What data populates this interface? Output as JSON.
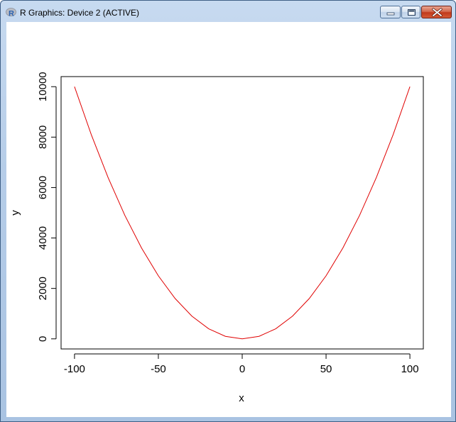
{
  "window": {
    "title": "R Graphics: Device 2 (ACTIVE)",
    "app_icon": "r-logo-icon",
    "controls": [
      "minimize-icon",
      "maximize-icon",
      "close-icon"
    ]
  },
  "chart_data": {
    "type": "line",
    "function": "y = x^2",
    "x": [
      -100,
      -90,
      -80,
      -70,
      -60,
      -50,
      -40,
      -30,
      -20,
      -10,
      0,
      10,
      20,
      30,
      40,
      50,
      60,
      70,
      80,
      90,
      100
    ],
    "y": [
      10000,
      8100,
      6400,
      4900,
      3600,
      2500,
      1600,
      900,
      400,
      100,
      0,
      100,
      400,
      900,
      1600,
      2500,
      3600,
      4900,
      6400,
      8100,
      10000
    ],
    "xlabel": "x",
    "ylabel": "y",
    "xlim": [
      -108,
      108
    ],
    "ylim": [
      -400,
      10400
    ],
    "xticks": [
      -100,
      -50,
      0,
      50,
      100
    ],
    "yticks": [
      0,
      2000,
      4000,
      6000,
      8000,
      10000
    ],
    "xtick_labels": [
      "-100",
      "-50",
      "0",
      "50",
      "100"
    ],
    "ytick_labels": [
      "0",
      "2000",
      "4000",
      "6000",
      "8000",
      "10000"
    ],
    "line_color": "#e00000",
    "grid": false,
    "legend": "none"
  }
}
